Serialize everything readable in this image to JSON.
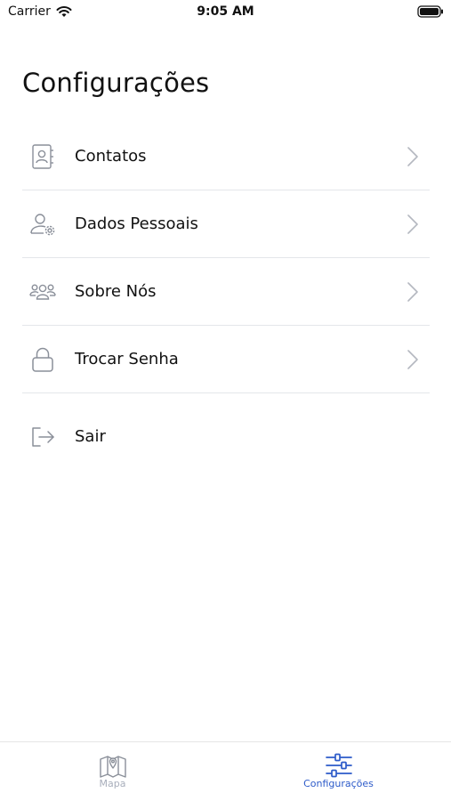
{
  "status_bar": {
    "carrier": "Carrier",
    "time": "9:05 AM"
  },
  "page": {
    "title": "Configurações"
  },
  "menu": {
    "items": [
      {
        "label": "Contatos",
        "icon": "contact-book-icon"
      },
      {
        "label": "Dados Pessoais",
        "icon": "user-settings-icon"
      },
      {
        "label": "Sobre Nós",
        "icon": "group-icon"
      },
      {
        "label": "Trocar Senha",
        "icon": "lock-icon"
      },
      {
        "label": "Sair",
        "icon": "logout-icon"
      }
    ]
  },
  "tab_bar": {
    "tabs": [
      {
        "label": "Mapa",
        "icon": "map-icon",
        "active": false
      },
      {
        "label": "Configurações",
        "icon": "sliders-icon",
        "active": true
      }
    ]
  },
  "colors": {
    "accent": "#2d5bc9",
    "inactive": "#a8aebb",
    "icon_gray": "#8a8f99",
    "divider": "#e4e6ea"
  }
}
